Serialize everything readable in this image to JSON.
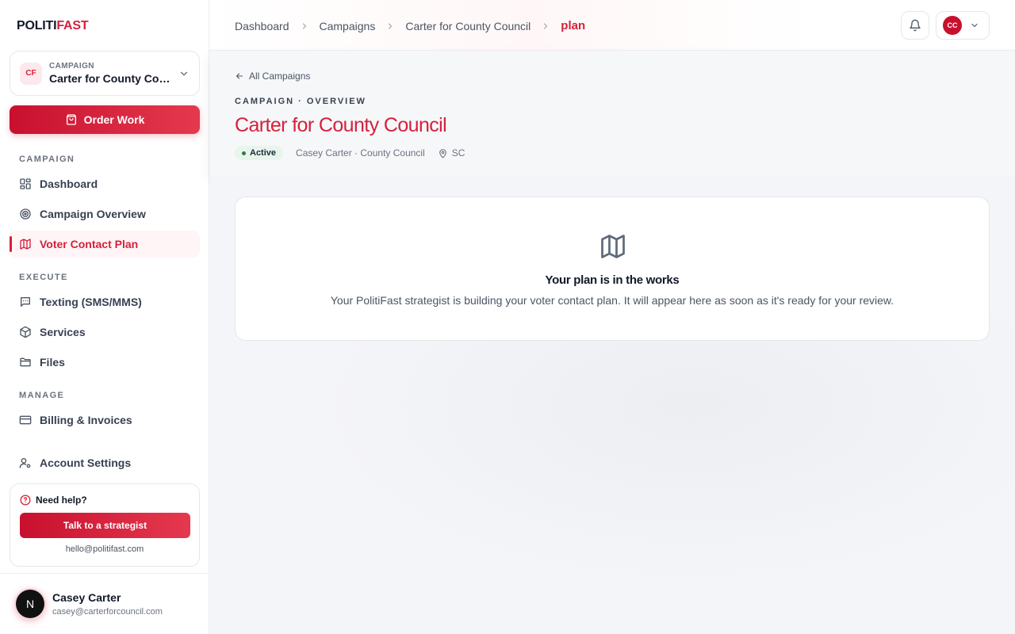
{
  "brand": {
    "part1": "POLITI",
    "part2": "FAST"
  },
  "campaign_switcher": {
    "badge": "CF",
    "label": "CAMPAIGN",
    "name": "Carter for County Council"
  },
  "order_button": {
    "label": "Order Work"
  },
  "nav": {
    "sections": {
      "campaign": "CAMPAIGN",
      "execute": "EXECUTE",
      "manage": "MANAGE"
    },
    "items": {
      "dashboard": "Dashboard",
      "campaign_overview": "Campaign Overview",
      "voter_contact_plan": "Voter Contact Plan",
      "texting": "Texting (SMS/MMS)",
      "services": "Services",
      "files": "Files",
      "billing": "Billing & Invoices",
      "account_settings": "Account Settings"
    },
    "active": "voter_contact_plan"
  },
  "help": {
    "title": "Need help?",
    "button": "Talk to a strategist",
    "email": "hello@politifast.com"
  },
  "user": {
    "initial": "N",
    "name": "Casey Carter",
    "email": "casey@carterforcouncil.com"
  },
  "breadcrumb": [
    "Dashboard",
    "Campaigns",
    "Carter for County Council",
    "plan"
  ],
  "topbar": {
    "account_initials": "CC"
  },
  "header": {
    "back_link": "All Campaigns",
    "eyebrow": "CAMPAIGN · OVERVIEW",
    "title": "Carter for County Council",
    "status": "Active",
    "candidate": "Casey Carter · County Council",
    "location": "SC"
  },
  "empty_state": {
    "icon": "map-icon",
    "title": "Your plan is in the works",
    "description": "Your PolitiFast strategist is building your voter contact plan. It will appear here as soon as it's ready for your review."
  },
  "colors": {
    "accent": "#d6203c",
    "status_bg": "#e8f5ec",
    "status_dot": "#2f7a4b"
  }
}
